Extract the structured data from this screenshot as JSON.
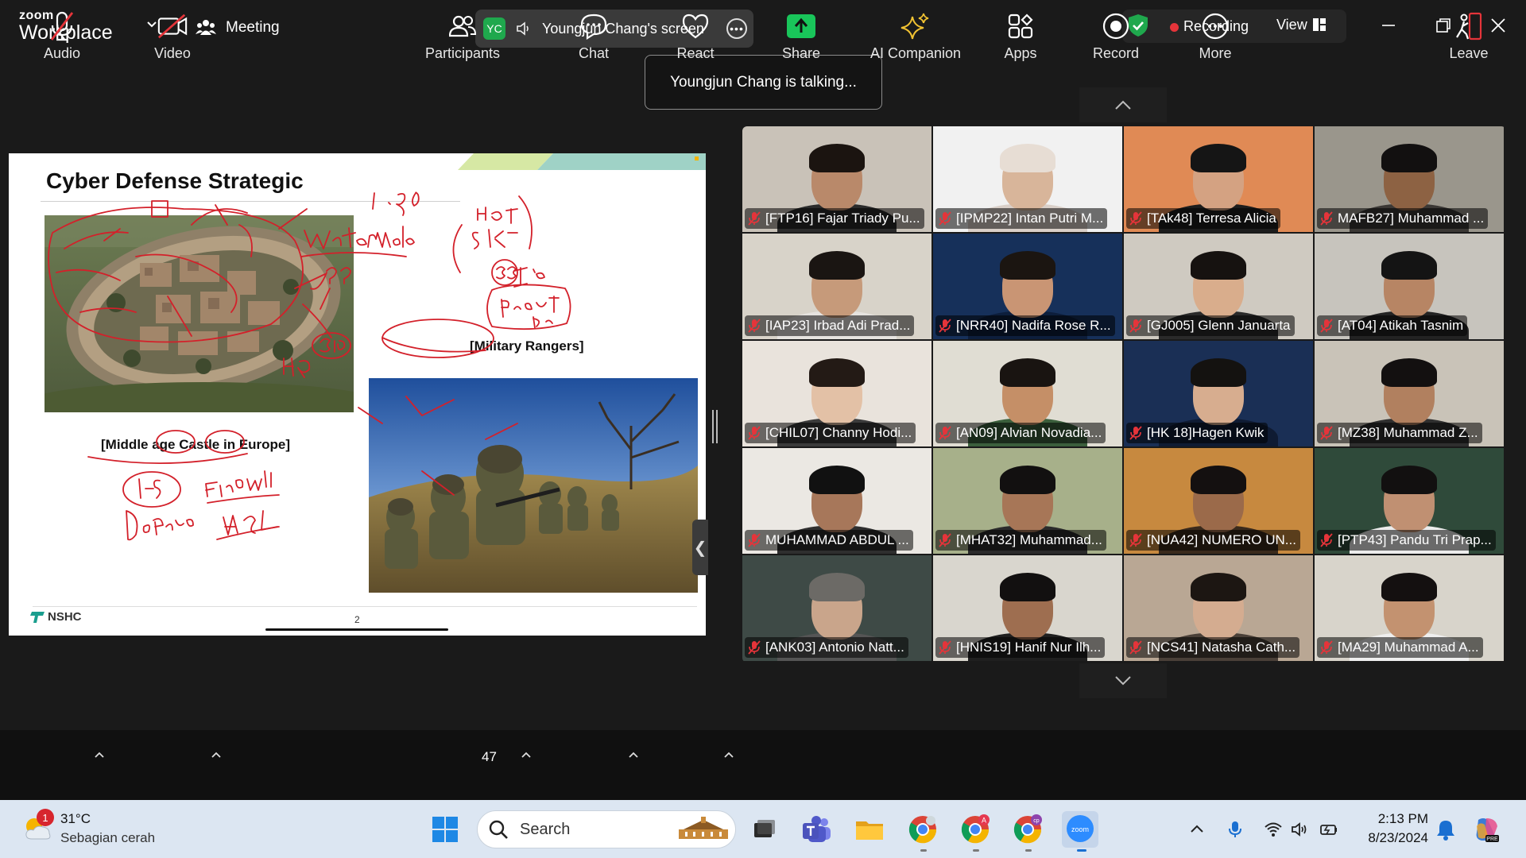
{
  "app": {
    "brand_top": "zoom",
    "brand_bottom": "Workplace"
  },
  "topbar": {
    "meeting_label": "Meeting",
    "share_initials": "YC",
    "share_title": "Youngjun Chang's screen",
    "recording_label": "Recording",
    "view_label": "View"
  },
  "talking_banner": "Youngjun Chang is talking...",
  "slide": {
    "title": "Cyber Defense Strategic",
    "castle_caption_prefix": "[Middle age ",
    "castle_caption_castle": "Castle",
    "castle_caption_in": " in ",
    "castle_caption_europe": "Europe",
    "castle_caption_suffix": "]",
    "rangers_caption": "[Military Rangers]",
    "logo_text": "NSHC",
    "page_number": "2"
  },
  "participants": [
    {
      "name": "[FTP16] Fajar Triady Pu...",
      "muted": true,
      "bg": "#c9c2b8",
      "skin": "#b9896a",
      "shirt": "#2b2b2b",
      "hair": "#1b1410"
    },
    {
      "name": "[IPMP22] Intan Putri M...",
      "muted": true,
      "bg": "#f1f1f1",
      "skin": "#d8b59a",
      "shirt": "#d9cfc8",
      "hair": "#e7ddd4"
    },
    {
      "name": "[TAk48] Terresa Alicia",
      "muted": true,
      "bg": "#e08a55",
      "skin": "#d4a282",
      "shirt": "#1d1d1d",
      "hair": "#151515"
    },
    {
      "name": "MAFB27] Muhammad ...",
      "muted": true,
      "bg": "#9a968c",
      "skin": "#8d6243",
      "shirt": "#3b3835",
      "hair": "#121010"
    },
    {
      "name": "[IAP23] Irbad Adi Prad...",
      "muted": true,
      "bg": "#d8d3c9",
      "skin": "#c69a7a",
      "shirt": "#e6e3df",
      "hair": "#1a1512"
    },
    {
      "name": "[NRR40] Nadifa Rose R...",
      "muted": true,
      "bg": "#16305a",
      "skin": "#c99574",
      "shirt": "#0d1e3c",
      "hair": "#1b1511"
    },
    {
      "name": "[GJ005] Glenn Januarta",
      "muted": true,
      "bg": "#cfcac1",
      "skin": "#d9ad8c",
      "shirt": "#2a2a2a",
      "hair": "#161210"
    },
    {
      "name": "[AT04] Atikah Tasnim",
      "muted": true,
      "bg": "#c7c4bd",
      "skin": "#b78564",
      "shirt": "#232323",
      "hair": "#141414"
    },
    {
      "name": "[CHIL07] Channy Hodi...",
      "muted": true,
      "bg": "#e9e3dc",
      "skin": "#e3c1a6",
      "shirt": "#3b3b3b",
      "hair": "#231a15"
    },
    {
      "name": "[AN09] Alvian Novadia...",
      "muted": true,
      "bg": "#e0ddd3",
      "skin": "#c58f67",
      "shirt": "#3b5f3c",
      "hair": "#191411"
    },
    {
      "name": "[HK 18]Hagen Kwik",
      "muted": true,
      "bg": "#1a2f55",
      "skin": "#d7ad8f",
      "shirt": "#0f1b33",
      "hair": "#141210"
    },
    {
      "name": "[MZ38] Muhammad Z...",
      "muted": true,
      "bg": "#c9c3b8",
      "skin": "#b1805f",
      "shirt": "#2f2f2f",
      "hair": "#131010"
    },
    {
      "name": "MUHAMMAD ABDUL ...",
      "muted": true,
      "bg": "#ebe8e3",
      "skin": "#a7775a",
      "shirt": "#2e2e2e",
      "hair": "#111"
    },
    {
      "name": "[MHAT32] Muhammad...",
      "muted": true,
      "bg": "#a7b08a",
      "skin": "#a77657",
      "shirt": "#2b2b2b",
      "hair": "#121010"
    },
    {
      "name": "[NUA42] NUMERO UN...",
      "muted": true,
      "bg": "#c7893f",
      "skin": "#9b6a4a",
      "shirt": "#3a2a1c",
      "hair": "#141010"
    },
    {
      "name": "[PTP43] Pandu Tri Prap...",
      "muted": true,
      "bg": "#2f4a3a",
      "skin": "#c09072",
      "shirt": "#ececec",
      "hair": "#121010"
    },
    {
      "name": "[ANK03] Antonio Natt...",
      "muted": true,
      "bg": "#3e4a46",
      "skin": "#c9a58b",
      "shirt": "#555",
      "hair": "#6c6a66"
    },
    {
      "name": "[HNIS19] Hanif Nur Ilh...",
      "muted": true,
      "bg": "#d9d6ce",
      "skin": "#9e6e50",
      "shirt": "#1f1f1f",
      "hair": "#121010"
    },
    {
      "name": "[NCS41] Natasha Cath...",
      "muted": true,
      "bg": "#b9a794",
      "skin": "#d4ac90",
      "shirt": "#4a4038",
      "hair": "#1c1612"
    },
    {
      "name": "[MA29] Muhammad A...",
      "muted": true,
      "bg": "#d8d4cb",
      "skin": "#c39270",
      "shirt": "#efefef",
      "hair": "#141010"
    }
  ],
  "toolbar": {
    "audio": "Audio",
    "video": "Video",
    "participants": "Participants",
    "participants_count": "47",
    "chat": "Chat",
    "react": "React",
    "share": "Share",
    "ai_companion": "AI Companion",
    "apps": "Apps",
    "record": "Record",
    "more": "More",
    "leave": "Leave"
  },
  "taskbar": {
    "weather_badge": "1",
    "weather_temp": "31°C",
    "weather_desc": "Sebagian cerah",
    "search_label": "Search",
    "zoom_app_label": "zoom",
    "time": "2:13 PM",
    "date": "8/23/2024"
  },
  "colors": {
    "accent_green": "#1fa84d",
    "record_red": "#e5343a",
    "share_green": "#19c55a",
    "leave_red": "#e5343a",
    "ink_red": "#d3202a"
  },
  "icons": [
    "chevron-down-icon",
    "meeting-icon",
    "speaker-icon",
    "more-icon",
    "shield-check-icon",
    "view-grid-icon",
    "minimize-icon",
    "restore-icon",
    "close-icon",
    "mic-off-icon",
    "video-off-icon",
    "participants-icon",
    "chat-icon",
    "heart-icon",
    "share-icon",
    "sparkle-icon",
    "apps-icon",
    "record-icon",
    "more-icon",
    "leave-icon"
  ]
}
